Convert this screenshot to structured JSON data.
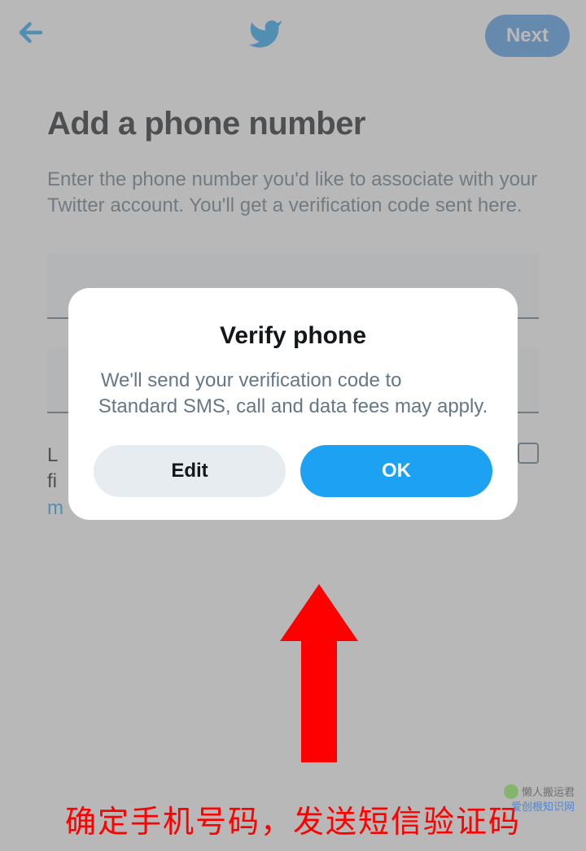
{
  "header": {
    "next_label": "Next"
  },
  "page": {
    "title": "Add a phone number",
    "description": "Enter the phone number you'd like to associate with your Twitter account. You'll get a verification code sent here.",
    "hint_prefix": "L",
    "hint_line2": "fi",
    "hint_link": "m"
  },
  "modal": {
    "title": "Verify phone",
    "text_line1": "We'll send your verification code to",
    "text_line2": "Standard SMS, call and data fees may apply.",
    "edit_label": "Edit",
    "ok_label": "OK"
  },
  "annotation": {
    "caption": "确定手机号码，发送短信验证码",
    "watermark1": "懒人搬运君",
    "watermark2": "爱创根知识网"
  }
}
